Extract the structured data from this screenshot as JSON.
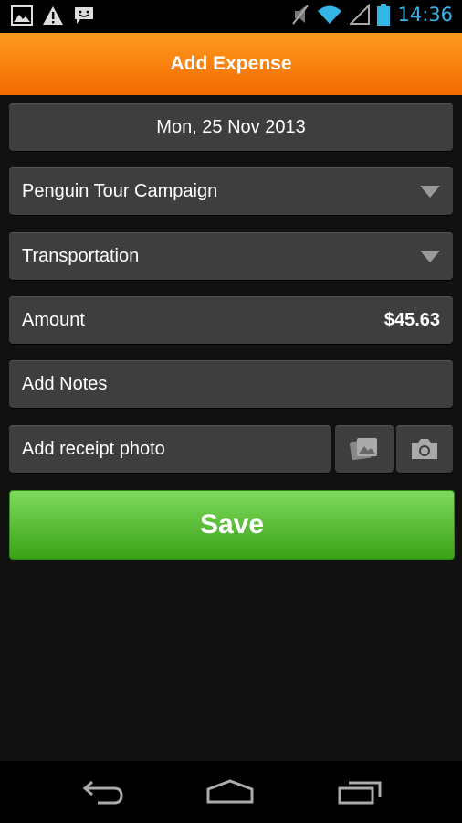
{
  "status_bar": {
    "time": "14:36",
    "icons": [
      "image-notification-icon",
      "warning-icon",
      "chat-icon",
      "mute-icon",
      "wifi-icon",
      "signal-icon",
      "battery-icon"
    ]
  },
  "header": {
    "title": "Add Expense"
  },
  "form": {
    "date": "Mon, 25 Nov 2013",
    "campaign": "Penguin Tour Campaign",
    "category": "Transportation",
    "amount_label": "Amount",
    "amount_value": "$45.63",
    "notes_placeholder": "Add Notes",
    "receipt_label": "Add receipt photo",
    "save_label": "Save"
  },
  "nav": {
    "icons": [
      "back-icon",
      "home-icon",
      "recent-apps-icon"
    ]
  },
  "colors": {
    "accent": "#f57c00",
    "save_green": "#4cb82a",
    "clock_blue": "#33b5e5"
  }
}
